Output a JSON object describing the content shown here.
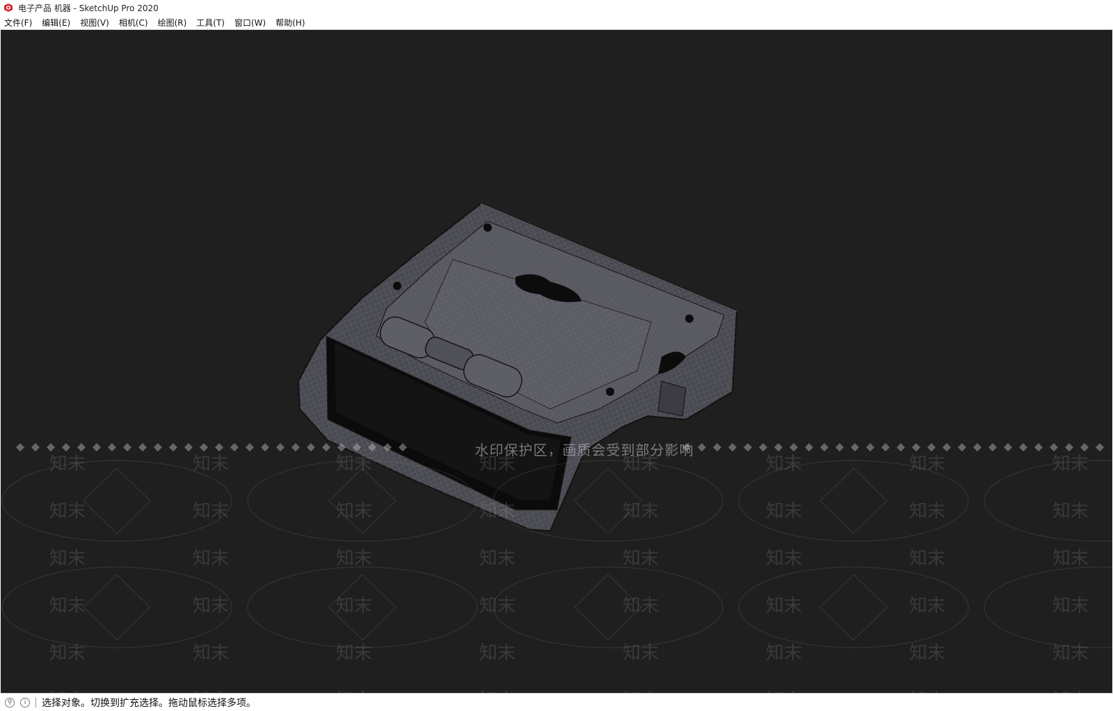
{
  "window": {
    "title": "电子产品 机器 - SketchUp Pro 2020",
    "icon": "sketchup-logo-icon"
  },
  "menubar": {
    "items": [
      {
        "label": "文件(F)"
      },
      {
        "label": "编辑(E)"
      },
      {
        "label": "视图(V)"
      },
      {
        "label": "相机(C)"
      },
      {
        "label": "绘图(R)"
      },
      {
        "label": "工具(T)"
      },
      {
        "label": "窗口(W)"
      },
      {
        "label": "帮助(H)"
      }
    ]
  },
  "viewport": {
    "background": "#1f1f1f",
    "model": "wireframe-device-model",
    "watermark_notice": "水印保护区，画质会受到部分影响",
    "watermark_brand": "知末"
  },
  "statusbar": {
    "icons": [
      "geo-location-icon",
      "credits-info-icon"
    ],
    "message": "选择对象。切换到扩充选择。拖动鼠标选择多项。"
  }
}
